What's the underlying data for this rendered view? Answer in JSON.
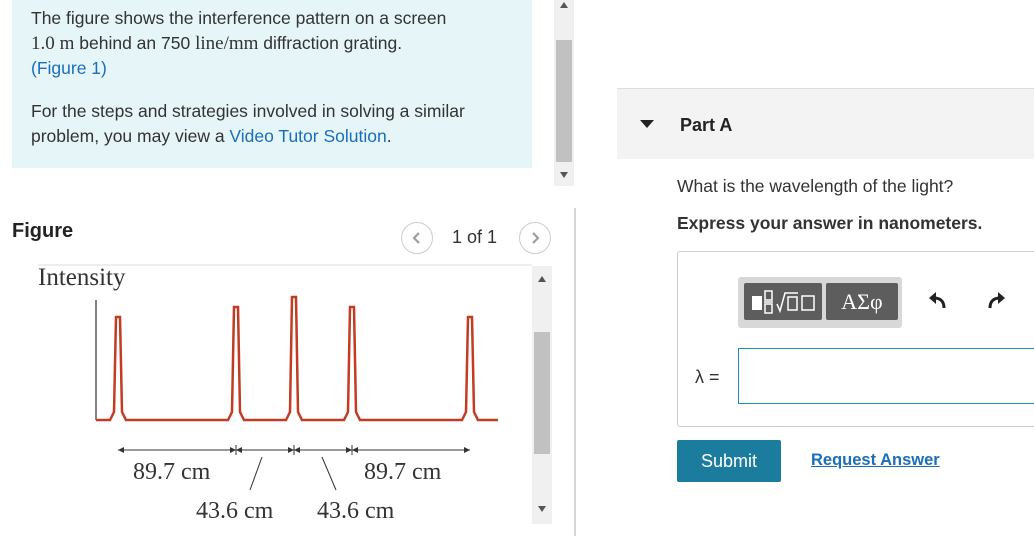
{
  "intro": {
    "p1_a": "The figure shows the interference pattern on a screen",
    "p1_dist": "1.0",
    "p1_unit_m": "m",
    "p1_b": " behind an 750 ",
    "p1_lines": "line/mm",
    "p1_c": " diffraction grating.",
    "figure_link": "(Figure 1)",
    "p2_a": "For the steps and strategies involved in solving a similar problem, you may view a ",
    "p2_link": "Video Tutor Solution",
    "p2_end": "."
  },
  "figure": {
    "title": "Figure",
    "counter": "1 of 1",
    "prev_icon": "chevron-left-icon",
    "next_icon": "chevron-right-icon",
    "y_label": "Intensity",
    "dim_outer_left": "89.7 cm",
    "dim_outer_right": "89.7 cm",
    "dim_inner_left": "43.6 cm",
    "dim_inner_right": "43.6 cm"
  },
  "part": {
    "title": "Part A",
    "question": "What is the wavelength of the light?",
    "instruction": "Express your answer in nanometers.",
    "toolbar": {
      "templates_icon": "math-templates-icon",
      "symbols_label": "ΑΣφ",
      "undo_icon": "undo-icon",
      "redo_icon": "redo-icon"
    },
    "variable_label": "λ =",
    "input_value": "",
    "submit_label": "Submit",
    "request_label": "Request Answer"
  },
  "colors": {
    "accent_link": "#1a6fb8",
    "submit_bg": "#1c7c9e",
    "intro_bg": "#e6f5f7",
    "peak_color": "#c23b22"
  }
}
